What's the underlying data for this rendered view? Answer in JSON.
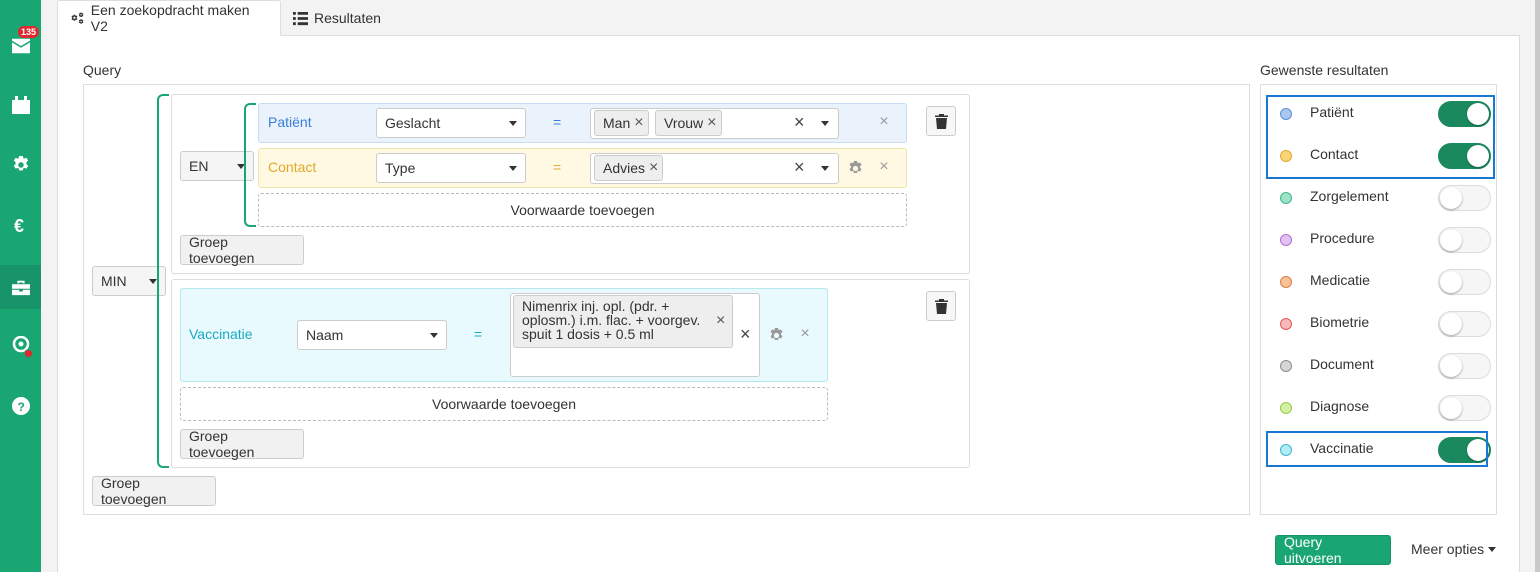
{
  "sidebar": {
    "mail_badge": "135",
    "icons": [
      "mail-icon",
      "calendar-icon",
      "settings-icon",
      "euro-icon",
      "briefcase-icon",
      "location-icon",
      "help-icon"
    ]
  },
  "tabs": [
    {
      "label": "Een zoekopdracht maken V2",
      "icon": "cogs-icon",
      "active": true
    },
    {
      "label": "Resultaten",
      "icon": "list-icon",
      "active": false
    }
  ],
  "query": {
    "label": "Query",
    "root_operator": "MIN",
    "group1": {
      "operator": "EN",
      "conditions": [
        {
          "entity": "Patiënt",
          "field": "Geslacht",
          "operator": "=",
          "values": [
            "Man",
            "Vrouw"
          ]
        },
        {
          "entity": "Contact",
          "field": "Type",
          "operator": "=",
          "values": [
            "Advies"
          ]
        }
      ],
      "add_condition_label": "Voorwaarde toevoegen",
      "add_group_label": "Groep toevoegen"
    },
    "group2": {
      "conditions": [
        {
          "entity": "Vaccinatie",
          "field": "Naam",
          "operator": "=",
          "values": [
            "Nimenrix inj. opl. (pdr. + oplosm.) i.m. flac. + voorgev. spuit 1 dosis + 0.5 ml"
          ]
        }
      ],
      "add_condition_label": "Voorwaarde toevoegen",
      "add_group_label": "Groep toevoegen"
    },
    "add_group_label": "Groep toevoegen"
  },
  "results": {
    "label": "Gewenste resultaten",
    "items": [
      {
        "label": "Patiënt",
        "color": "#a9c8f0",
        "border": "#5b8fd6",
        "on": true
      },
      {
        "label": "Contact",
        "color": "#f8d57a",
        "border": "#e0a92a",
        "on": true
      },
      {
        "label": "Zorgelement",
        "color": "#9ee3c6",
        "border": "#3cb98a",
        "on": false
      },
      {
        "label": "Procedure",
        "color": "#e2c2f2",
        "border": "#b170d1",
        "on": false
      },
      {
        "label": "Medicatie",
        "color": "#f7c29a",
        "border": "#e07d3c",
        "on": false
      },
      {
        "label": "Biometrie",
        "color": "#f6b8b8",
        "border": "#e05b5b",
        "on": false
      },
      {
        "label": "Document",
        "color": "#d6d6d6",
        "border": "#8e8e8e",
        "on": false
      },
      {
        "label": "Diagnose",
        "color": "#d4f0a6",
        "border": "#98cc4a",
        "on": false
      },
      {
        "label": "Vaccinatie",
        "color": "#b3ecf5",
        "border": "#3ab8cf",
        "on": true
      }
    ]
  },
  "actions": {
    "run_label": "Query uitvoeren",
    "more_label": "Meer opties"
  },
  "colors": {
    "brand": "#1aa672",
    "patient": "#3a7fd5",
    "contact": "#e0a92a",
    "vaccinatie": "#1aa9c4"
  }
}
